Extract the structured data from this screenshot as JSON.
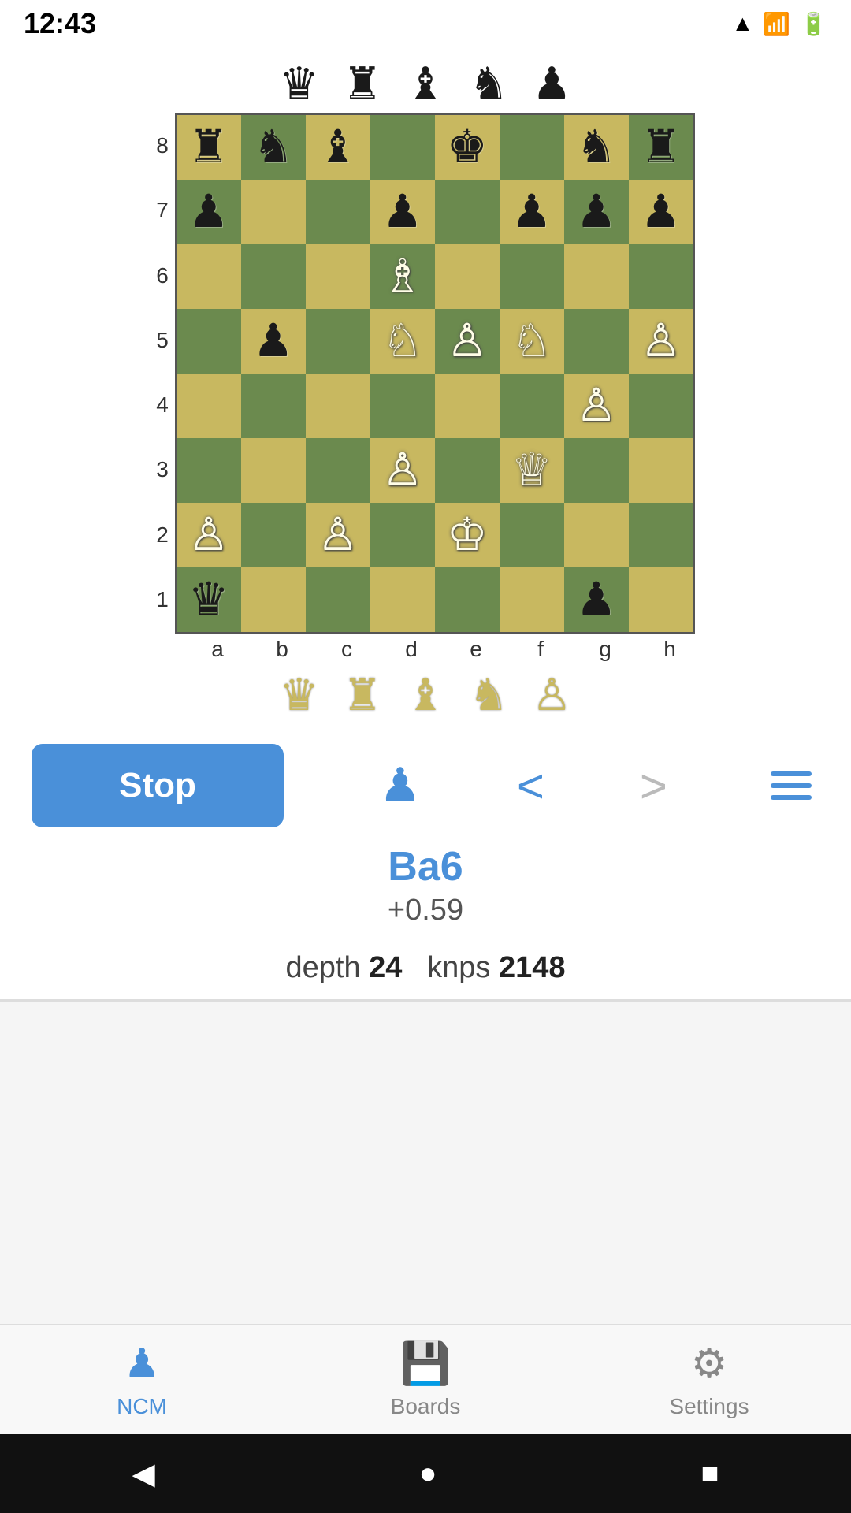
{
  "statusBar": {
    "time": "12:43"
  },
  "topPieces": {
    "pieces": [
      "♛",
      "♜",
      "♝",
      "♞",
      "♟"
    ]
  },
  "board": {
    "rankLabels": [
      "8",
      "7",
      "6",
      "5",
      "4",
      "3",
      "2",
      "1"
    ],
    "fileLabels": [
      "a",
      "b",
      "c",
      "d",
      "e",
      "f",
      "g",
      "h"
    ],
    "cells": [
      {
        "rank": 8,
        "file": "a",
        "piece": "♜",
        "color": "black",
        "bg": "light"
      },
      {
        "rank": 8,
        "file": "b",
        "piece": "♞",
        "color": "black",
        "bg": "dark"
      },
      {
        "rank": 8,
        "file": "c",
        "piece": "♝",
        "color": "black",
        "bg": "light"
      },
      {
        "rank": 8,
        "file": "d",
        "piece": "",
        "color": "",
        "bg": "dark"
      },
      {
        "rank": 8,
        "file": "e",
        "piece": "♚",
        "color": "black",
        "bg": "light"
      },
      {
        "rank": 8,
        "file": "f",
        "piece": "",
        "color": "",
        "bg": "dark"
      },
      {
        "rank": 8,
        "file": "g",
        "piece": "♞",
        "color": "black",
        "bg": "light"
      },
      {
        "rank": 8,
        "file": "h",
        "piece": "♜",
        "color": "black",
        "bg": "dark"
      },
      {
        "rank": 7,
        "file": "a",
        "piece": "♟",
        "color": "black",
        "bg": "dark"
      },
      {
        "rank": 7,
        "file": "b",
        "piece": "",
        "color": "",
        "bg": "light"
      },
      {
        "rank": 7,
        "file": "c",
        "piece": "",
        "color": "",
        "bg": "dark"
      },
      {
        "rank": 7,
        "file": "d",
        "piece": "♟",
        "color": "black",
        "bg": "light"
      },
      {
        "rank": 7,
        "file": "e",
        "piece": "",
        "color": "",
        "bg": "dark"
      },
      {
        "rank": 7,
        "file": "f",
        "piece": "♟",
        "color": "black",
        "bg": "light"
      },
      {
        "rank": 7,
        "file": "g",
        "piece": "♟",
        "color": "black",
        "bg": "dark"
      },
      {
        "rank": 7,
        "file": "h",
        "piece": "♟",
        "color": "black",
        "bg": "light"
      },
      {
        "rank": 6,
        "file": "a",
        "piece": "",
        "color": "",
        "bg": "light"
      },
      {
        "rank": 6,
        "file": "b",
        "piece": "",
        "color": "",
        "bg": "dark"
      },
      {
        "rank": 6,
        "file": "c",
        "piece": "",
        "color": "",
        "bg": "light"
      },
      {
        "rank": 6,
        "file": "d",
        "piece": "♗",
        "color": "white",
        "bg": "dark"
      },
      {
        "rank": 6,
        "file": "e",
        "piece": "",
        "color": "",
        "bg": "light"
      },
      {
        "rank": 6,
        "file": "f",
        "piece": "",
        "color": "",
        "bg": "dark"
      },
      {
        "rank": 6,
        "file": "g",
        "piece": "",
        "color": "",
        "bg": "light"
      },
      {
        "rank": 6,
        "file": "h",
        "piece": "",
        "color": "",
        "bg": "dark"
      },
      {
        "rank": 5,
        "file": "a",
        "piece": "",
        "color": "",
        "bg": "dark"
      },
      {
        "rank": 5,
        "file": "b",
        "piece": "♟",
        "color": "black",
        "bg": "light"
      },
      {
        "rank": 5,
        "file": "c",
        "piece": "",
        "color": "",
        "bg": "dark"
      },
      {
        "rank": 5,
        "file": "d",
        "piece": "♘",
        "color": "white",
        "bg": "light"
      },
      {
        "rank": 5,
        "file": "e",
        "piece": "♙",
        "color": "white",
        "bg": "dark"
      },
      {
        "rank": 5,
        "file": "f",
        "piece": "♘",
        "color": "white",
        "bg": "light"
      },
      {
        "rank": 5,
        "file": "g",
        "piece": "",
        "color": "",
        "bg": "dark"
      },
      {
        "rank": 5,
        "file": "h",
        "piece": "♙",
        "color": "white",
        "bg": "light"
      },
      {
        "rank": 4,
        "file": "a",
        "piece": "",
        "color": "",
        "bg": "light"
      },
      {
        "rank": 4,
        "file": "b",
        "piece": "",
        "color": "",
        "bg": "dark"
      },
      {
        "rank": 4,
        "file": "c",
        "piece": "",
        "color": "",
        "bg": "light"
      },
      {
        "rank": 4,
        "file": "d",
        "piece": "",
        "color": "",
        "bg": "dark"
      },
      {
        "rank": 4,
        "file": "e",
        "piece": "",
        "color": "",
        "bg": "light"
      },
      {
        "rank": 4,
        "file": "f",
        "piece": "",
        "color": "",
        "bg": "dark"
      },
      {
        "rank": 4,
        "file": "g",
        "piece": "♙",
        "color": "white",
        "bg": "light"
      },
      {
        "rank": 4,
        "file": "h",
        "piece": "",
        "color": "",
        "bg": "dark"
      },
      {
        "rank": 3,
        "file": "a",
        "piece": "",
        "color": "",
        "bg": "dark"
      },
      {
        "rank": 3,
        "file": "b",
        "piece": "",
        "color": "",
        "bg": "light"
      },
      {
        "rank": 3,
        "file": "c",
        "piece": "",
        "color": "",
        "bg": "dark"
      },
      {
        "rank": 3,
        "file": "d",
        "piece": "♙",
        "color": "white",
        "bg": "light"
      },
      {
        "rank": 3,
        "file": "e",
        "piece": "",
        "color": "",
        "bg": "dark"
      },
      {
        "rank": 3,
        "file": "f",
        "piece": "♕",
        "color": "white",
        "bg": "light"
      },
      {
        "rank": 3,
        "file": "g",
        "piece": "",
        "color": "",
        "bg": "dark"
      },
      {
        "rank": 3,
        "file": "h",
        "piece": "",
        "color": "",
        "bg": "light"
      },
      {
        "rank": 2,
        "file": "a",
        "piece": "♙",
        "color": "white",
        "bg": "light"
      },
      {
        "rank": 2,
        "file": "b",
        "piece": "",
        "color": "",
        "bg": "dark"
      },
      {
        "rank": 2,
        "file": "c",
        "piece": "♙",
        "color": "white",
        "bg": "light"
      },
      {
        "rank": 2,
        "file": "d",
        "piece": "",
        "color": "",
        "bg": "dark"
      },
      {
        "rank": 2,
        "file": "e",
        "piece": "♔",
        "color": "white",
        "bg": "light"
      },
      {
        "rank": 2,
        "file": "f",
        "piece": "",
        "color": "",
        "bg": "dark"
      },
      {
        "rank": 2,
        "file": "g",
        "piece": "",
        "color": "",
        "bg": "light"
      },
      {
        "rank": 2,
        "file": "h",
        "piece": "",
        "color": "",
        "bg": "dark"
      },
      {
        "rank": 1,
        "file": "a",
        "piece": "♛",
        "color": "black",
        "bg": "dark"
      },
      {
        "rank": 1,
        "file": "b",
        "piece": "",
        "color": "",
        "bg": "light"
      },
      {
        "rank": 1,
        "file": "c",
        "piece": "",
        "color": "",
        "bg": "dark"
      },
      {
        "rank": 1,
        "file": "d",
        "piece": "",
        "color": "",
        "bg": "light"
      },
      {
        "rank": 1,
        "file": "e",
        "piece": "",
        "color": "",
        "bg": "dark"
      },
      {
        "rank": 1,
        "file": "f",
        "piece": "",
        "color": "",
        "bg": "light"
      },
      {
        "rank": 1,
        "file": "g",
        "piece": "♟",
        "color": "black",
        "bg": "dark"
      },
      {
        "rank": 1,
        "file": "h",
        "piece": "",
        "color": "",
        "bg": "light"
      }
    ]
  },
  "bottomPieces": {
    "pieces": [
      "♛",
      "♜",
      "♝",
      "♞",
      "♙"
    ]
  },
  "controls": {
    "stopLabel": "Stop",
    "prevIcon": "<",
    "nextIcon": ">",
    "moveName": "Ba6",
    "moveScore": "+0.59",
    "depthLabel": "depth",
    "depthValue": "24",
    "knpsLabel": "knps",
    "knpsValue": "2148"
  },
  "bottomNav": {
    "items": [
      {
        "id": "ncm",
        "label": "NCM",
        "icon": "♟",
        "active": true
      },
      {
        "id": "boards",
        "label": "Boards",
        "icon": "💾",
        "active": false
      },
      {
        "id": "settings",
        "label": "Settings",
        "icon": "⚙",
        "active": false
      }
    ]
  },
  "androidNav": {
    "back": "◀",
    "home": "●",
    "recent": "■"
  }
}
